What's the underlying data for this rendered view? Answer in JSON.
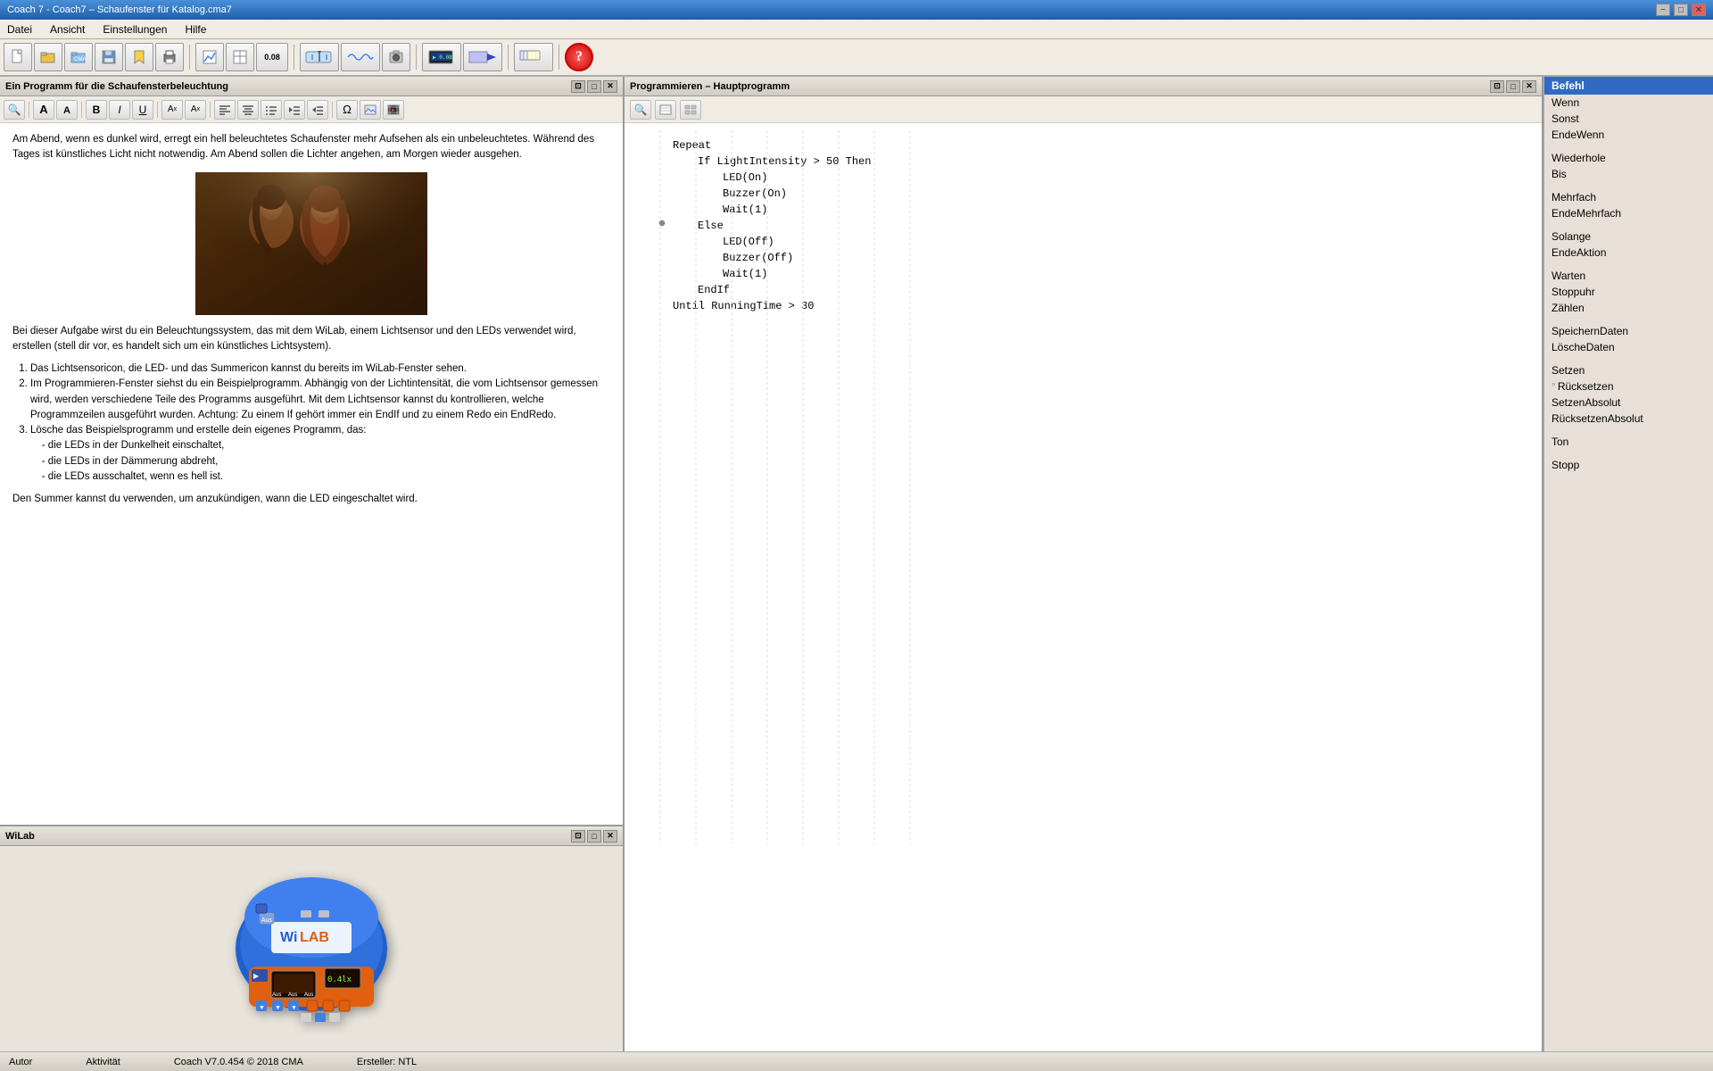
{
  "titlebar": {
    "title": "Coach 7 - Coach7 – Schaufenster für Katalog.cma7",
    "controls": [
      "−",
      "□",
      "✕"
    ]
  },
  "menubar": {
    "items": [
      "Datei",
      "Ansicht",
      "Einstellungen",
      "Hilfe"
    ]
  },
  "toolbar": {
    "buttons": [
      {
        "name": "new",
        "icon": "📄"
      },
      {
        "name": "open",
        "icon": "📂"
      },
      {
        "name": "open-cma",
        "icon": "📁"
      },
      {
        "name": "save",
        "icon": "💾"
      },
      {
        "name": "bookmark",
        "icon": "🔖"
      },
      {
        "name": "print",
        "icon": "🖨"
      },
      {
        "name": "separator1"
      },
      {
        "name": "diagram",
        "icon": "📊"
      },
      {
        "name": "table",
        "icon": "⊞"
      },
      {
        "name": "value",
        "icon": "0.08"
      },
      {
        "name": "separator2"
      },
      {
        "name": "measure",
        "icon": "⚙"
      },
      {
        "name": "signal",
        "icon": "∿"
      },
      {
        "name": "capture",
        "icon": "📷"
      },
      {
        "name": "separator3"
      },
      {
        "name": "display",
        "icon": "🖥"
      },
      {
        "name": "video",
        "icon": "▶"
      },
      {
        "name": "separator4"
      },
      {
        "name": "zoom",
        "icon": "🔍"
      },
      {
        "name": "help",
        "icon": "?"
      }
    ]
  },
  "left_panel": {
    "title": "Ein Programm für die Schaufensterbeleuchtung",
    "content": {
      "paragraph1": "Am Abend, wenn es dunkel wird, erregt ein hell beleuchtetes Schaufenster mehr Aufsehen als ein unbeleuchtetes. Während des Tages ist künstliches Licht nicht notwendig. Am Abend sollen die Lichter angehen, am Morgen wieder ausgehen.",
      "paragraph2": "Bei dieser Aufgabe wirst du ein Beleuchtungssystem, das mit dem WiLab, einem Lichtsensor und den LEDs verwendet wird, erstellen (stell dir vor, es handelt sich um ein künstliches Lichtsystem).",
      "list_items": [
        "Das Lichtsensoricon, die LED- und das Summericon kannst du bereits im WiLab-Fenster sehen.",
        "Im Programmieren-Fenster siehst du ein Beispielprogramm. Abhängig von der Lichtintensität, die vom Lichtsensor gemessen wird, werden verschiedene Teile des Programms ausgeführt. Mit dem Lichtsensor kannst du kontrollieren, welche Programmzeilen ausgeführt wurden. Achtung: Zu einem If gehört immer ein EndIf und zu einem Redo ein EndRedo.",
        "Lösche das Beispielsprogramm und erstelle dein eigenes Programm, das:\n    - die LEDs in der Dunkelheit einschaltet,\n    - die LEDs in der Dämmerung abdreht,\n    - die LEDs ausschaltet, wenn es hell ist."
      ],
      "paragraph3": "Den Summer kannst du verwenden, um anzukündigen, wann die LED eingeschaltet wird."
    }
  },
  "wilab_panel": {
    "title": "WiLab"
  },
  "prog_panel": {
    "title": "Programmieren – Hauptprogramm",
    "code_lines": [
      {
        "indent": 0,
        "text": "Repeat"
      },
      {
        "indent": 1,
        "text": "If LightIntensity > 50 Then"
      },
      {
        "indent": 2,
        "text": "LED(On)"
      },
      {
        "indent": 2,
        "text": "Buzzer(On)"
      },
      {
        "indent": 2,
        "text": "Wait(1)"
      },
      {
        "indent": 1,
        "text": "Else"
      },
      {
        "indent": 2,
        "text": "LED(Off)"
      },
      {
        "indent": 2,
        "text": "Buzzer(Off)"
      },
      {
        "indent": 2,
        "text": "Wait(1)"
      },
      {
        "indent": 1,
        "text": "EndIf"
      },
      {
        "indent": 0,
        "text": "Until RunningTime > 30"
      }
    ]
  },
  "commands_panel": {
    "title": "Befehl",
    "items": [
      {
        "label": "Wenn",
        "selected": false
      },
      {
        "label": "Sonst",
        "selected": false
      },
      {
        "label": "EndeWenn",
        "selected": false
      },
      {
        "label": "",
        "spacer": true
      },
      {
        "label": "Wiederhole",
        "selected": false
      },
      {
        "label": "Bis",
        "selected": false
      },
      {
        "label": "",
        "spacer": true
      },
      {
        "label": "Mehrfach",
        "selected": false
      },
      {
        "label": "EndeMehrfach",
        "selected": false
      },
      {
        "label": "",
        "spacer": true
      },
      {
        "label": "Solange",
        "selected": false
      },
      {
        "label": "EndeAktion",
        "selected": false
      },
      {
        "label": "",
        "spacer": true
      },
      {
        "label": "Warten",
        "selected": false
      },
      {
        "label": "Stoppuhr",
        "selected": false
      },
      {
        "label": "Zählen",
        "selected": false
      },
      {
        "label": "",
        "spacer": true
      },
      {
        "label": "SpeichernDaten",
        "selected": false
      },
      {
        "label": "LöscheDaten",
        "selected": false
      },
      {
        "label": "",
        "spacer": true
      },
      {
        "label": "Setzen",
        "selected": false
      },
      {
        "label": "° Rücksetzen",
        "selected": false
      },
      {
        "label": "SetzenAbsolut",
        "selected": false
      },
      {
        "label": "RücksetzenAbsolut",
        "selected": false
      },
      {
        "label": "",
        "spacer": true
      },
      {
        "label": "Ton",
        "selected": false
      },
      {
        "label": "",
        "spacer": true
      },
      {
        "label": "Stopp",
        "selected": false
      }
    ]
  },
  "status_bar": {
    "author_label": "Autor",
    "activity_label": "Aktivität",
    "version_label": "Coach V7.0.454 © 2018 CMA",
    "creator_label": "Ersteller: NTL"
  }
}
